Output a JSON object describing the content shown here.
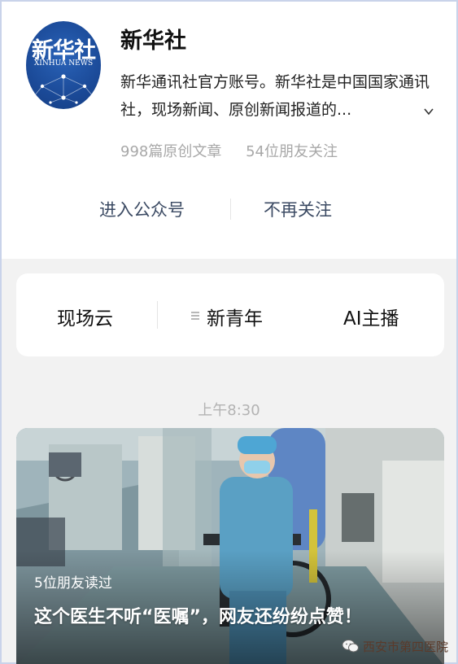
{
  "account": {
    "logo_text_cn": "新华社",
    "logo_text_en": "XINHUA NEWS",
    "name": "新华社",
    "description": "新华通讯社官方账号。新华社是中国国家通讯社，现场新闻、原创新闻报道的...",
    "original_articles": "998篇原创文章",
    "friends_following": "54位朋友关注"
  },
  "actions": {
    "enter": "进入公众号",
    "unfollow": "不再关注"
  },
  "menu": {
    "items": [
      "现场云",
      "新青年",
      "AI主播"
    ]
  },
  "feed": {
    "time": "上午8:30",
    "article": {
      "readers": "5位朋友读过",
      "title": "这个医生不听“医嘱”，网友还纷纷点赞！"
    }
  },
  "watermark": {
    "text": "西安市第四医院"
  },
  "colors": {
    "action_text": "#3b4a63",
    "logo_blue": "#1b4a98",
    "muted": "#a8a8a8"
  }
}
